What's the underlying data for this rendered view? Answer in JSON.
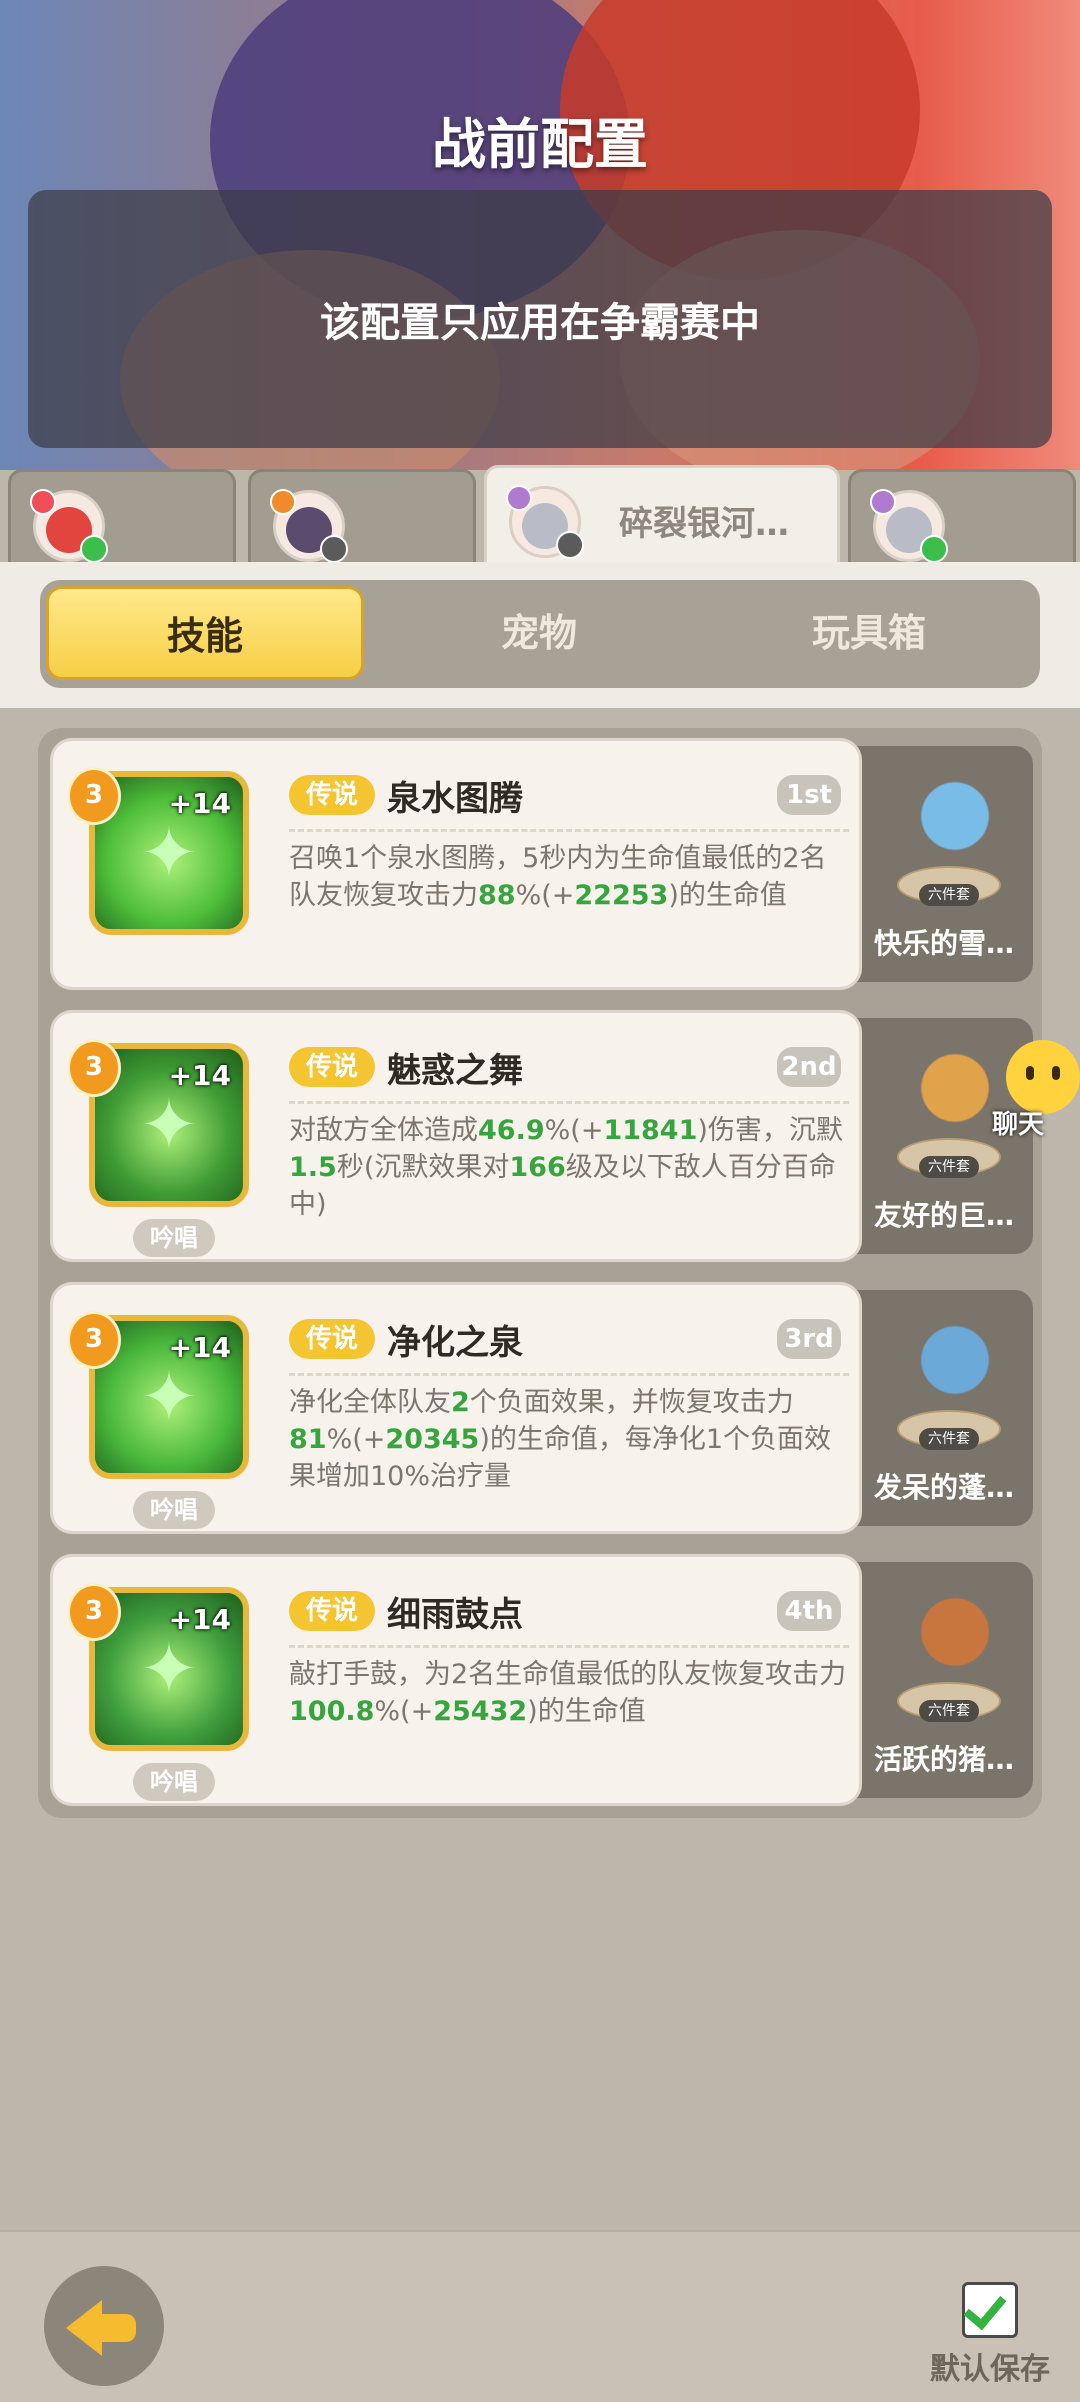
{
  "header": {
    "title": "战前配置",
    "notice": "该配置只应用在争霸赛中"
  },
  "hero_tabs": [
    {
      "name": "",
      "avatar_color": "#e1453d",
      "status_color": "#3bbf4a",
      "active": false
    },
    {
      "name": "",
      "avatar_color": "#5b4b6f",
      "status_color": "#5b5b5b",
      "active": false
    },
    {
      "name": "碎裂银河…",
      "avatar_color": "#b9bcc6",
      "status_color": "#5b5b5b",
      "active": true
    },
    {
      "name": "",
      "avatar_color": "#b9bcc6",
      "status_color": "#3bbf4a",
      "active": false
    }
  ],
  "tabs": [
    "技能",
    "宠物",
    "玩具箱"
  ],
  "active_tab": "技能",
  "skills": [
    {
      "level": "3",
      "plus": "+14",
      "rarity": "传说",
      "name": "泉水图腾",
      "rank": "1st",
      "desc_parts": [
        [
          "召唤1个泉水图腾，5秒内为生命值最低的2名队友恢复攻击力",
          false
        ],
        [
          "88",
          true
        ],
        [
          "%(+",
          false
        ],
        [
          "22253",
          true
        ],
        [
          ")的生命值",
          false
        ]
      ],
      "chant": "",
      "pet_name": "快乐的雪…",
      "pet_tag": "六件套",
      "icon_color": "#4fbf3a"
    },
    {
      "level": "3",
      "plus": "+14",
      "rarity": "传说",
      "name": "魅惑之舞",
      "rank": "2nd",
      "desc_parts": [
        [
          "对敌方全体造成",
          false
        ],
        [
          "46.9",
          true
        ],
        [
          "%(+",
          false
        ],
        [
          "11841",
          true
        ],
        [
          ")伤害，沉默",
          false
        ],
        [
          "1.5",
          true
        ],
        [
          "秒(沉默效果对",
          false
        ],
        [
          "166",
          true
        ],
        [
          "级及以下敌人百分百命中)",
          false
        ]
      ],
      "chant": "吟唱",
      "pet_name": "友好的巨…",
      "pet_tag": "六件套",
      "icon_color": "#3f9b34"
    },
    {
      "level": "3",
      "plus": "+14",
      "rarity": "传说",
      "name": "净化之泉",
      "rank": "3rd",
      "desc_parts": [
        [
          "净化全体队友",
          false
        ],
        [
          "2",
          true
        ],
        [
          "个负面效果，并恢复攻击力",
          false
        ],
        [
          "81",
          true
        ],
        [
          "%(+",
          false
        ],
        [
          "20345",
          true
        ],
        [
          ")的生命值，每净化1个负面效果增加10%治疗量",
          false
        ]
      ],
      "chant": "吟唱",
      "pet_name": "发呆的蓬…",
      "pet_tag": "六件套",
      "icon_color": "#49b83c"
    },
    {
      "level": "3",
      "plus": "+14",
      "rarity": "传说",
      "name": "细雨鼓点",
      "rank": "4th",
      "desc_parts": [
        [
          "敲打手鼓，为2名生命值最低的队友恢复攻击力",
          false
        ],
        [
          "100.8",
          true
        ],
        [
          "%(+",
          false
        ],
        [
          "25432",
          true
        ],
        [
          ")的生命值",
          false
        ]
      ],
      "chant": "吟唱",
      "pet_name": "活跃的猪…",
      "pet_tag": "六件套",
      "icon_color": "#3f9e3d"
    }
  ],
  "chat": {
    "label": "聊天"
  },
  "footer": {
    "save_label": "默认保存",
    "save_checked": true
  }
}
